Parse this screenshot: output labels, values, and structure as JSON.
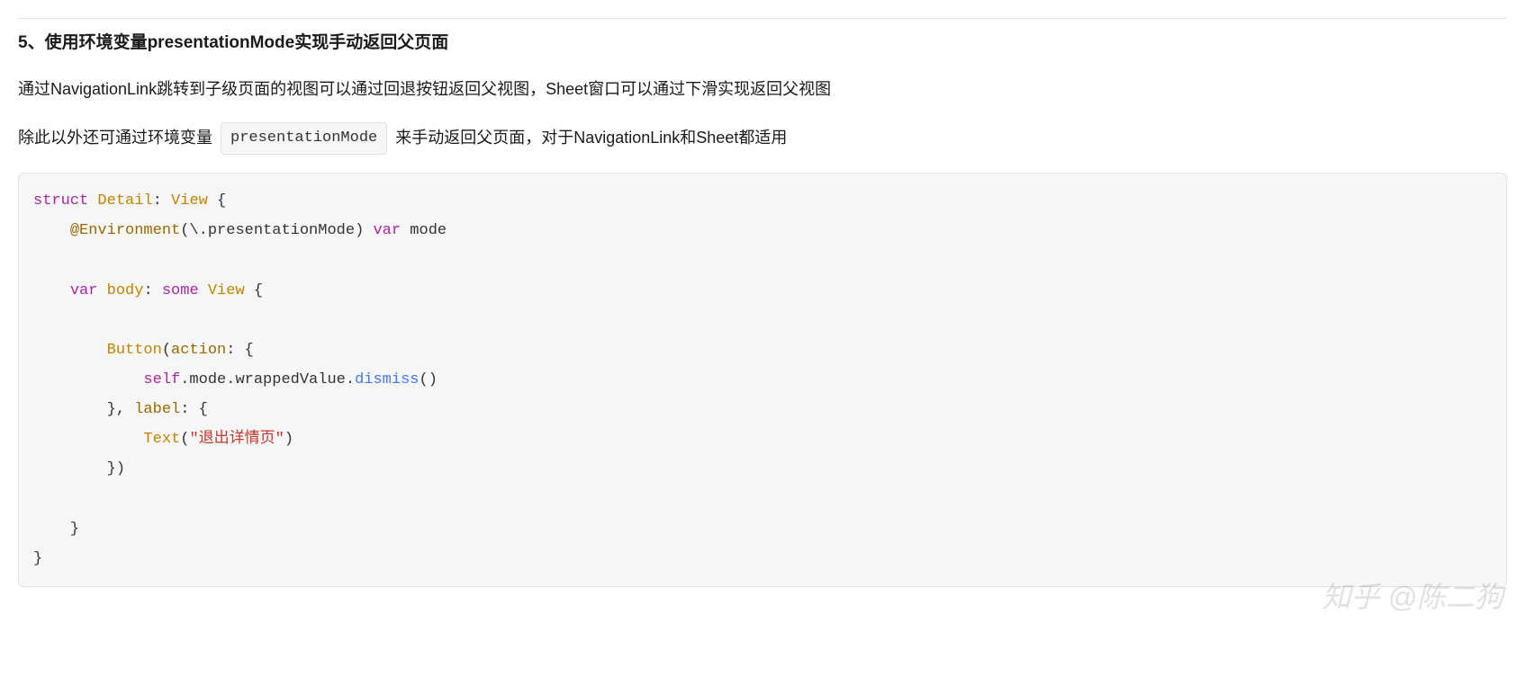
{
  "section": {
    "heading": "5、使用环境变量presentationMode实现手动返回父页面",
    "para1": "通过NavigationLink跳转到子级页面的视图可以通过回退按钮返回父视图，Sheet窗口可以通过下滑实现返回父视图",
    "para2_a": "除此以外还可通过环境变量 ",
    "para2_code": "presentationMode",
    "para2_b": " 来手动返回父页面，对于NavigationLink和Sheet都适用"
  },
  "code": {
    "l1_kw": "struct",
    "l1_name": " Detail",
    "l1_colon": ": ",
    "l1_type": "View",
    "l1_brace": " {",
    "l2_indent": "    ",
    "l2_attr": "@Environment",
    "l2_open": "(\\.presentationMode) ",
    "l2_var": "var",
    "l2_mode": " mode",
    "l3": "",
    "l4_indent": "    ",
    "l4_var": "var",
    "l4_body": " body",
    "l4_colon": ": ",
    "l4_some": "some",
    "l4_view": " View",
    "l4_brace": " {",
    "l5": "",
    "l6_indent": "        ",
    "l6_button": "Button",
    "l6_open": "(",
    "l6_action": "action",
    "l6_colon": ": {",
    "l7_indent": "            ",
    "l7_self": "self",
    "l7_dot": ".mode.wrappedValue.",
    "l7_dismiss": "dismiss",
    "l7_paren": "()",
    "l8_indent": "        }, ",
    "l8_label": "label",
    "l8_colon": ": {",
    "l9_indent": "            ",
    "l9_text": "Text",
    "l9_open": "(",
    "l9_str": "\"退出详情页\"",
    "l9_close": ")",
    "l10": "        })",
    "l11": "",
    "l12": "    }",
    "l13": "}"
  },
  "watermark": "知乎 @陈二狗"
}
